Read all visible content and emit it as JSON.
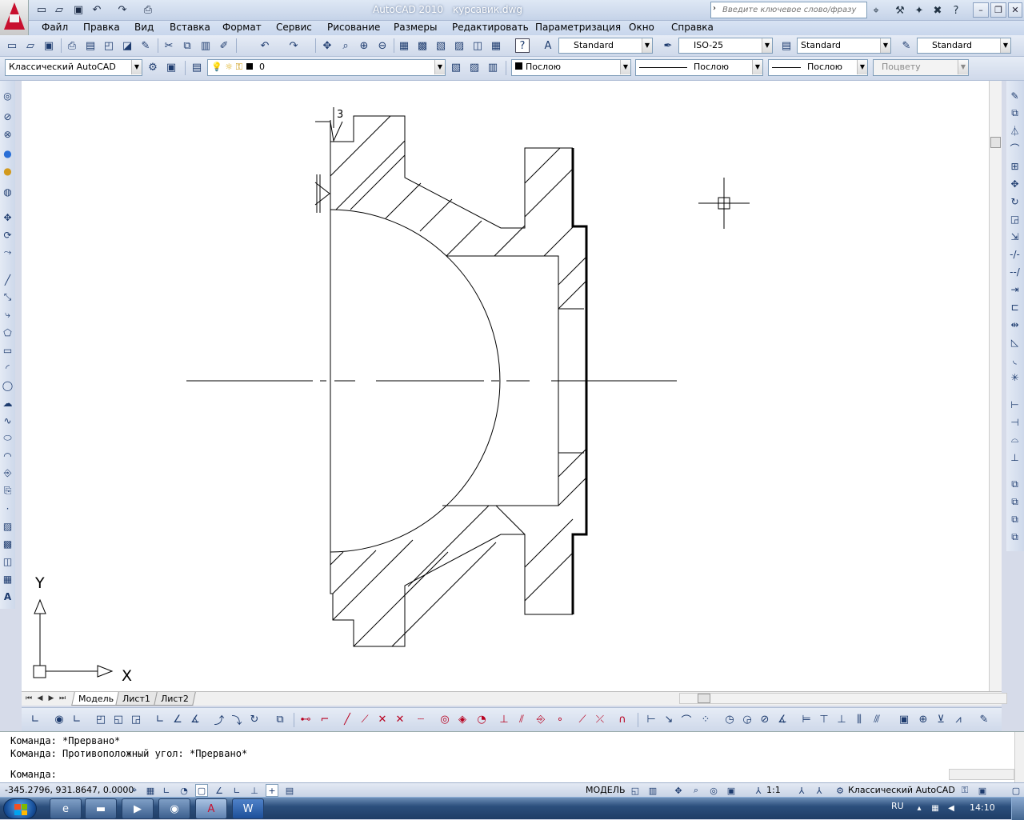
{
  "title": {
    "app": "AutoCAD 2010",
    "file": "курсавик.dwg"
  },
  "search": {
    "placeholder": "Введите ключевое слово/фразу"
  },
  "menu": [
    "Файл",
    "Правка",
    "Вид",
    "Вставка",
    "Формат",
    "Сервис",
    "Рисование",
    "Размеры",
    "Редактировать",
    "Параметризация",
    "Окно",
    "Справка"
  ],
  "styles": {
    "text_style": "Standard",
    "dim_style": "ISO-25",
    "table_style": "Standard",
    "mleader_style": "Standard"
  },
  "workspace": "Классический AutoCAD",
  "layer": {
    "name": "0"
  },
  "properties": {
    "color": "Послою",
    "linetype": "Послою",
    "lineweight": "Послою",
    "plotstyle": "Поцвету"
  },
  "drawing": {
    "annotation": "3",
    "ucs_x": "X",
    "ucs_y": "Y"
  },
  "layout_tabs": [
    "Модель",
    "Лист1",
    "Лист2"
  ],
  "command_history": [
    "Команда: *Прервано*",
    "Команда: Противоположный угол: *Прервано*"
  ],
  "command_prompt": "Команда:",
  "status": {
    "coords": "-345.2796, 931.8647, 0.0000",
    "space": "МОДЕЛЬ",
    "scale": "1:1",
    "workspace": "Классический AutoCAD"
  },
  "taskbar": {
    "lang": "RU",
    "time": "14:10"
  },
  "colors": {
    "accent": "#c8102e",
    "canvas": "#ffffff",
    "ui": "#d6dbe9"
  }
}
